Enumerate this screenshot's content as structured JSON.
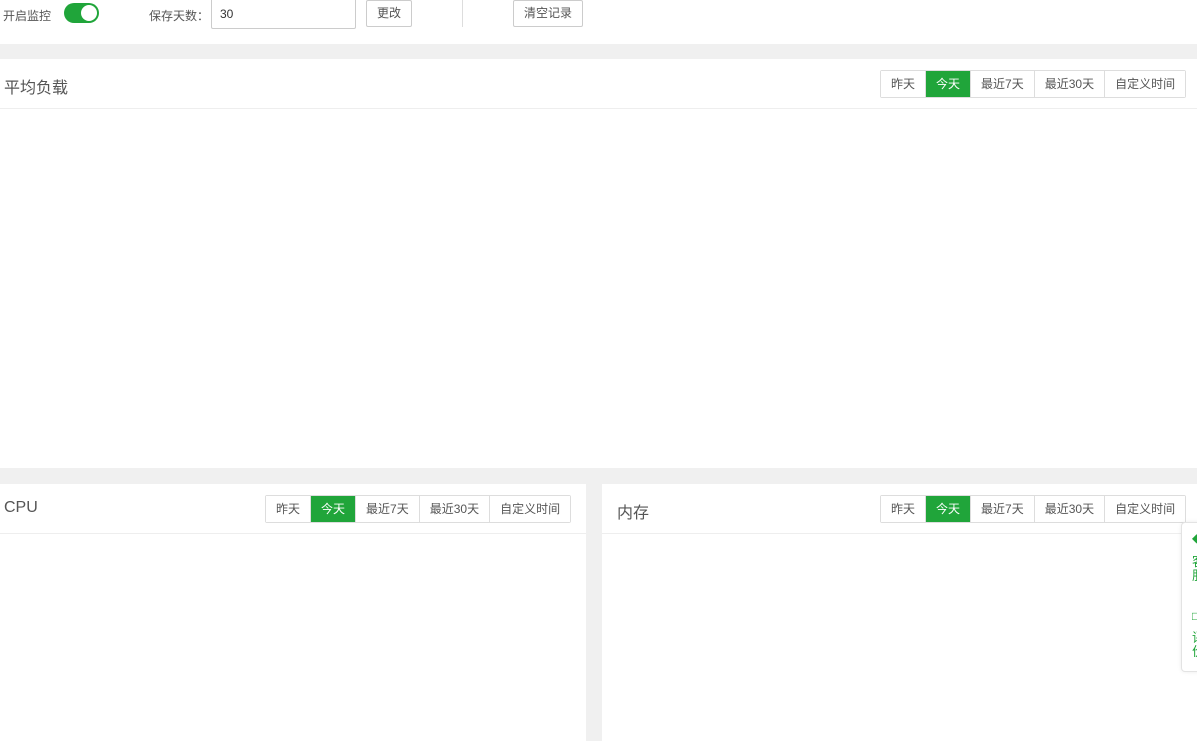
{
  "toolbar": {
    "monitor_label": "开启监控",
    "monitor_enabled": true,
    "retention_label": "保存天数：",
    "retention_value": "30",
    "change_button": "更改",
    "clear_button": "清空记录"
  },
  "time_ranges": [
    "昨天",
    "今天",
    "最近7天",
    "最近30天",
    "自定义时间"
  ],
  "active_range": "今天",
  "panels": {
    "load": {
      "title": "平均负载"
    },
    "cpu": {
      "title": "CPU"
    },
    "memory": {
      "title": "内存"
    }
  },
  "float_widget": {
    "item1_text": "客服",
    "item2_text": "评价",
    "accent": "#20a53a"
  },
  "colors": {
    "accent": "#20a53a"
  }
}
